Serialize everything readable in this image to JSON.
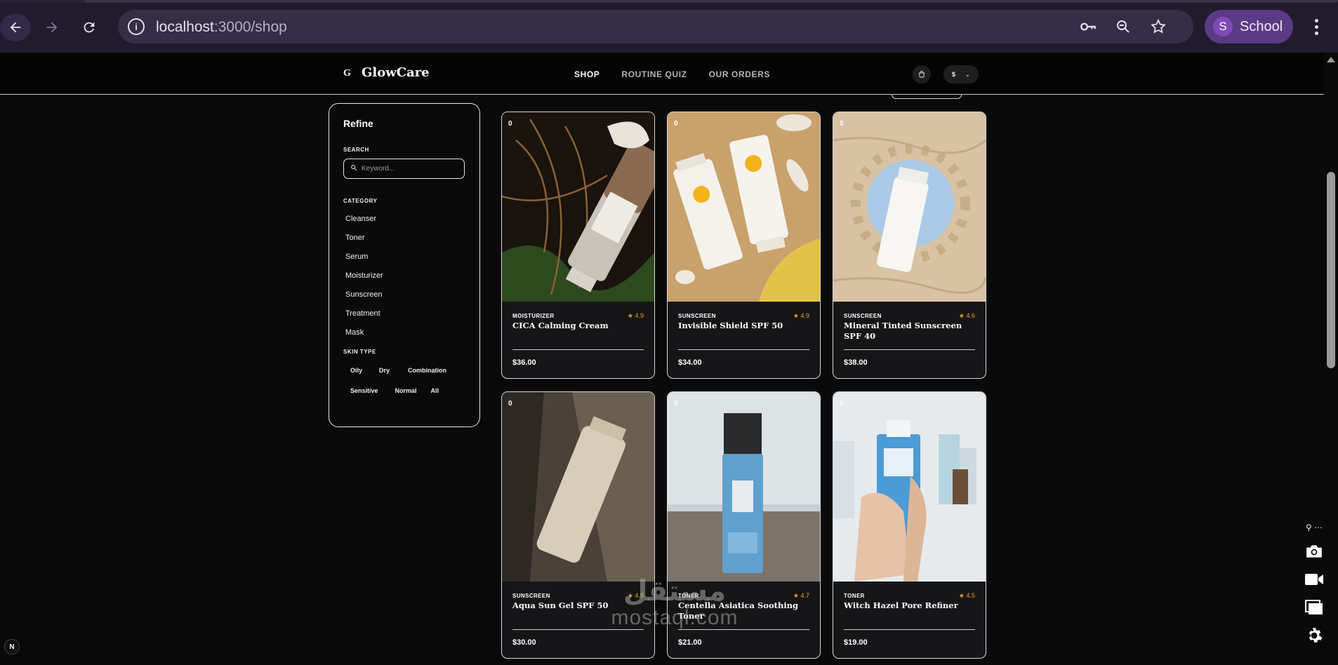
{
  "browser": {
    "url_host": "localhost",
    "url_path": ":3000/shop",
    "profile_initial": "S",
    "profile_name": "School",
    "icons": [
      "back-icon",
      "forward-icon",
      "reload-icon",
      "site-info-icon",
      "password-key-icon",
      "zoom-icon",
      "bookmark-star-icon",
      "more-menu-icon"
    ]
  },
  "site": {
    "logo_mark": "G",
    "brand": "GlowCare",
    "nav": [
      "SHOP",
      "ROUTINE QUIZ",
      "OUR ORDERS"
    ],
    "active_nav": "SHOP",
    "currency": "$"
  },
  "sidebar": {
    "title": "Refine",
    "search_label": "SEARCH",
    "search_placeholder": "Keyword...",
    "category_label": "CATEGORY",
    "categories": [
      "Cleanser",
      "Toner",
      "Serum",
      "Moisturizer",
      "Sunscreen",
      "Treatment",
      "Mask"
    ],
    "skin_type_label": "SKIN TYPE",
    "skin_types": [
      "Oily",
      "Dry",
      "Combination",
      "Sensitive",
      "Normal",
      "All"
    ]
  },
  "products": [
    {
      "badge": "0",
      "category": "MOISTURIZER",
      "rating": "4.9",
      "name": "CICA Calming Cream",
      "price": "$36.00"
    },
    {
      "badge": "0",
      "category": "SUNSCREEN",
      "rating": "4.9",
      "name": "Invisible Shield SPF 50",
      "price": "$34.00"
    },
    {
      "badge": "0",
      "category": "SUNSCREEN",
      "rating": "4.6",
      "name": "Mineral Tinted Sunscreen SPF 40",
      "price": "$38.00"
    },
    {
      "badge": "0",
      "category": "SUNSCREEN",
      "rating": "4.8",
      "name": "Aqua Sun Gel SPF 50",
      "price": "$30.00"
    },
    {
      "badge": "0",
      "category": "TONER",
      "rating": "4.7",
      "name": "Centella Asiatica Soothing Toner",
      "price": "$21.00"
    },
    {
      "badge": "0",
      "category": "TONER",
      "rating": "4.5",
      "name": "Witch Hazel Pore Refiner",
      "price": "$19.00"
    }
  ],
  "watermark": {
    "line1": "مستقل",
    "line2": "mostaql.com"
  },
  "dev_badge": "N"
}
